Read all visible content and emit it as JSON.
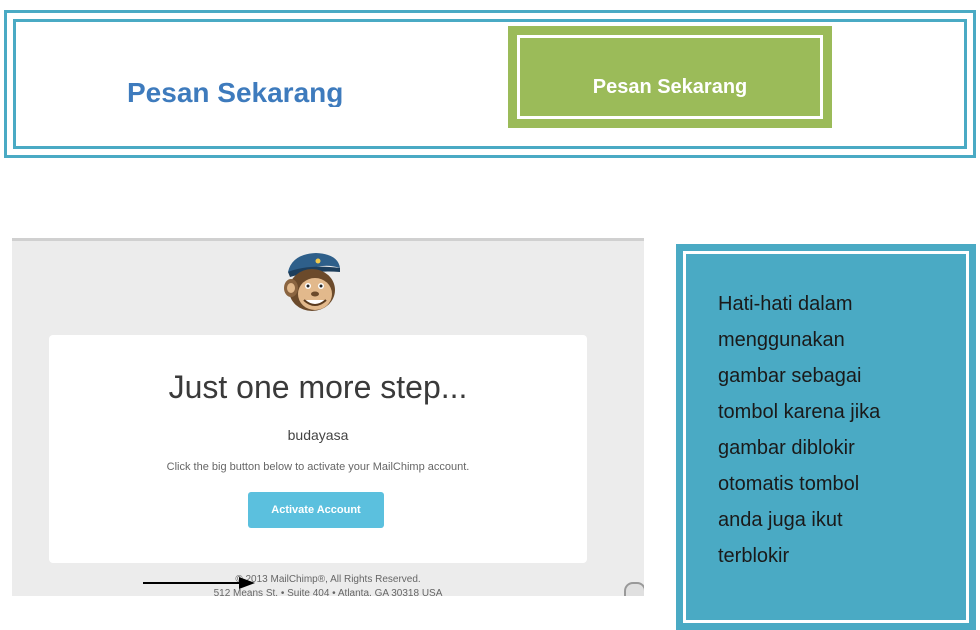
{
  "banner": {
    "text_label": "Pesan Sekarang",
    "button_label": "Pesan Sekarang",
    "border_color": "#4aaac4",
    "button_color": "#9bbb59",
    "text_color": "#3e7bbd"
  },
  "email": {
    "headline": "Just one more step...",
    "username": "budayasa",
    "description": "Click the big button below to activate your MailChimp account.",
    "activate_label": "Activate Account",
    "footer_line1": "© 2013 MailChimp®, All Rights Reserved.",
    "footer_line2": "512 Means St. • Suite 404 • Atlanta, GA 30318 USA",
    "mascot_icon": "chimp-mascot-icon",
    "button_color": "#5bc0de"
  },
  "note": {
    "lines": [
      "Hati-hati dalam",
      "menggunakan",
      "gambar sebagai",
      "tombol karena jika",
      "gambar diblokir",
      "otomatis tombol",
      "anda juga ikut",
      "terblokir"
    ],
    "background": "#4aaac4"
  }
}
